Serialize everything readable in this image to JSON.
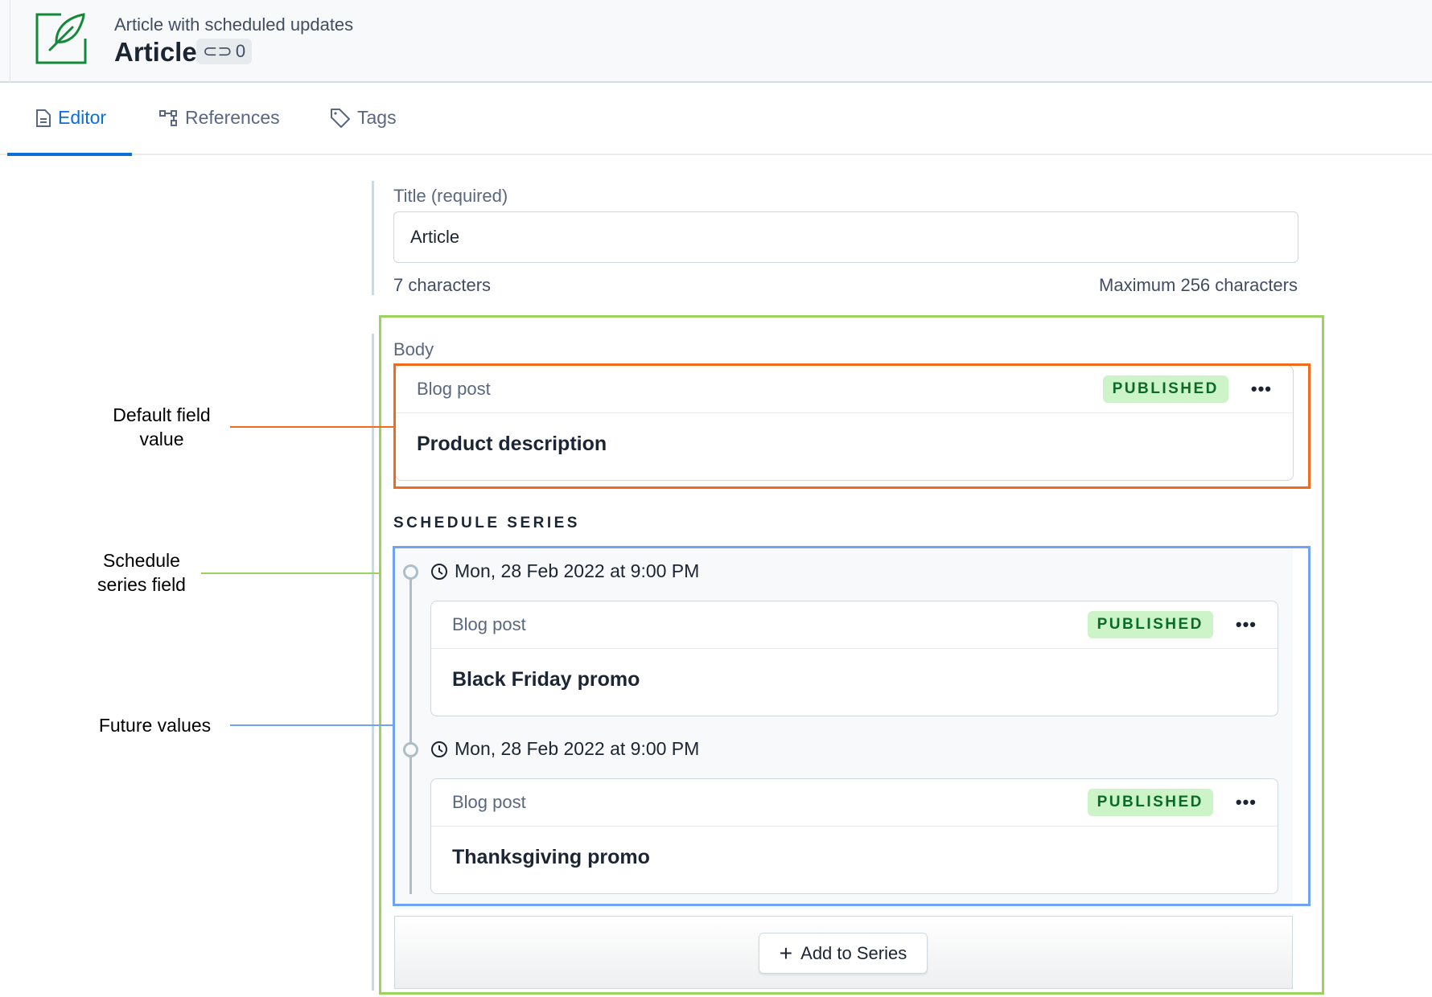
{
  "header": {
    "subtitle": "Article with scheduled updates",
    "title": "Article",
    "links_count": "0"
  },
  "tabs": [
    {
      "label": "Editor",
      "icon": "document-icon",
      "active": true
    },
    {
      "label": "References",
      "icon": "hierarchy-icon"
    },
    {
      "label": "Tags",
      "icon": "tag-icon"
    }
  ],
  "title_field": {
    "label": "Title (required)",
    "value": "Article",
    "char_count": "7 characters",
    "max": "Maximum 256 characters"
  },
  "body_field": {
    "label": "Body",
    "default_entry": {
      "content_type": "Blog post",
      "status": "PUBLISHED",
      "title": "Product description"
    }
  },
  "schedule": {
    "heading": "SCHEDULE SERIES",
    "items": [
      {
        "date": "Mon, 28 Feb 2022 at 9:00 PM",
        "content_type": "Blog post",
        "status": "PUBLISHED",
        "title": "Black Friday promo"
      },
      {
        "date": "Mon, 28 Feb 2022 at 9:00 PM",
        "content_type": "Blog post",
        "status": "PUBLISHED",
        "title": "Thanksgiving promo"
      }
    ],
    "add_label": "Add to Series"
  },
  "annotations": {
    "default": "Default field value",
    "schedule": "Schedule series field",
    "future": "Future values"
  },
  "colors": {
    "accent": "#0d6ed9",
    "published_bg": "#cdf3c9",
    "published_text": "#0a6b28",
    "annotation_default": "#f26b1d",
    "annotation_schedule": "#9bd35f",
    "annotation_future": "#6fa3f5"
  }
}
